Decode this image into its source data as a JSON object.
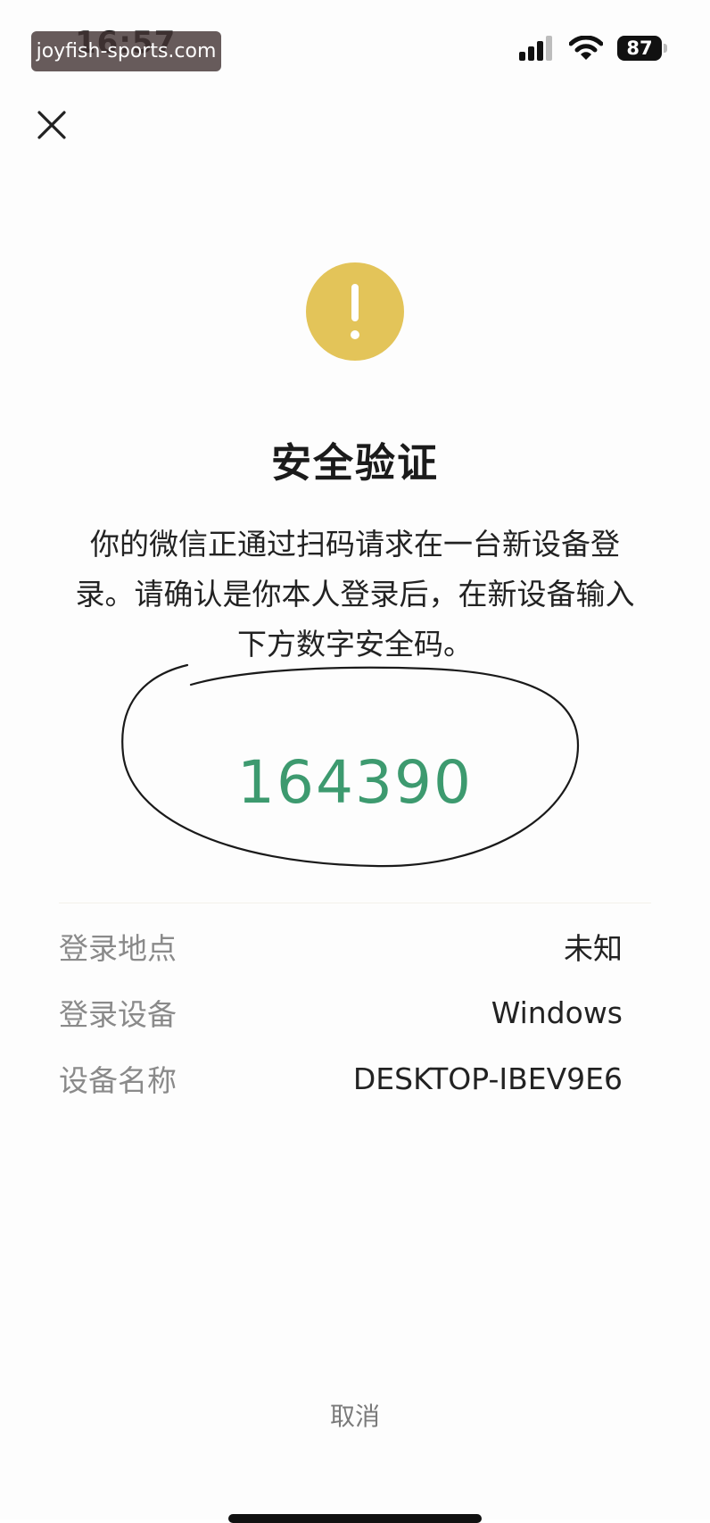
{
  "status_bar": {
    "time": "16:57",
    "watermark": "joyfish-sports.com",
    "battery": "87",
    "icons": [
      "cellular-signal-icon",
      "wifi-icon",
      "battery-icon"
    ]
  },
  "header": {
    "close_icon": "close-icon"
  },
  "warning": {
    "icon": "exclamation-icon",
    "color": "#e3c459"
  },
  "title": "安全验证",
  "description": "你的微信正通过扫码请求在一台新设备登录。请确认是你本人登录后，在新设备输入下方数字安全码。",
  "security_code": "164390",
  "colors": {
    "code": "#3d9a6f",
    "label": "#8a8a8a"
  },
  "details": [
    {
      "label": "登录地点",
      "value": "未知"
    },
    {
      "label": "登录设备",
      "value": "Windows"
    },
    {
      "label": "设备名称",
      "value": "DESKTOP-IBEV9E6"
    }
  ],
  "cancel_label": "取消"
}
